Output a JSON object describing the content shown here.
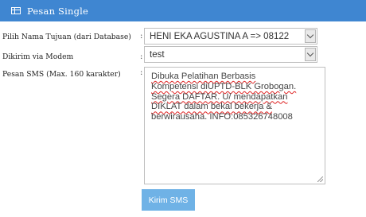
{
  "panel": {
    "title": "Pesan Single"
  },
  "form": {
    "recipient": {
      "label": "Pilih Nama Tujuan (dari Database)",
      "separator": ":",
      "selected": "HENI EKA AGUSTINA A => 08122"
    },
    "modem": {
      "label": "Dikirim via Modem",
      "separator": ":",
      "selected": "test"
    },
    "message": {
      "label": "Pesan SMS (Max. 160 karakter)",
      "separator": ":",
      "lines": [
        "Dibuka Pelatihan Berbasis",
        "Kompetensi diUPTD-BLK Grobogan.",
        "Segera DAFTAR. U/ mendapatkan",
        "DIKLAT dalam bekal bekerja &",
        "berwirausaha. INFO:085326748008"
      ]
    },
    "submit_label": "Kirim SMS"
  }
}
